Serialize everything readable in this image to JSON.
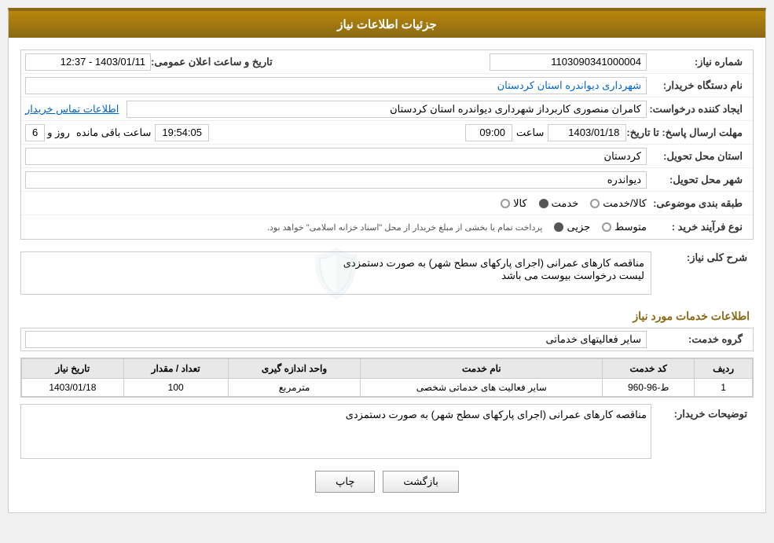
{
  "header": {
    "title": "جزئیات اطلاعات نیاز"
  },
  "fields": {
    "need_number_label": "شماره نیاز:",
    "need_number_value": "1103090341000004",
    "announce_date_label": "تاریخ و ساعت اعلان عمومی:",
    "announce_date_value": "1403/01/11 - 12:37",
    "buyer_org_label": "نام دستگاه خریدار:",
    "buyer_org_value": "شهرداری دیواندره استان کردستان",
    "creator_label": "ایجاد کننده درخواست:",
    "creator_value": "کامران منصوری کاربرداز شهرداری دیواندره استان کردستان",
    "contact_link": "اطلاعات تماس خریدار",
    "deadline_label": "مهلت ارسال پاسخ: تا تاریخ:",
    "deadline_date": "1403/01/18",
    "deadline_time_label": "ساعت",
    "deadline_time": "09:00",
    "deadline_day_label": "روز و",
    "deadline_days": "6",
    "deadline_remaining_label": "ساعت باقی مانده",
    "deadline_remaining": "19:54:05",
    "province_label": "استان محل تحویل:",
    "province_value": "کردستان",
    "city_label": "شهر محل تحویل:",
    "city_value": "دیواندره",
    "category_label": "طبقه بندی موضوعی:",
    "category_kala": "کالا",
    "category_khadamat": "خدمت",
    "category_kala_khadamat": "کالا/خدمت",
    "process_label": "نوع فرآیند خرید :",
    "process_jozi": "جزیی",
    "process_motawaset": "متوسط",
    "process_note": "پرداخت تمام یا بخشی از مبلغ خریدار از محل \"اسناد خزانه اسلامی\" خواهد بود.",
    "need_description_label": "شرح کلی نیاز:",
    "need_description": "مناقصه کارهای عمرانی (اجرای پارکهای سطح شهر) به صورت دستمزدی\nلیست درخواست بیوست می باشد",
    "services_section_title": "اطلاعات خدمات مورد نیاز",
    "service_group_label": "گروه خدمت:",
    "service_group_value": "سایر فعالیتهای خدماتی",
    "table": {
      "col_row": "ردیف",
      "col_code": "کد خدمت",
      "col_name": "نام خدمت",
      "col_unit": "واحد اندازه گیری",
      "col_qty": "تعداد / مقدار",
      "col_date": "تاریخ نیاز",
      "rows": [
        {
          "row": "1",
          "code": "ط-96-960",
          "name": "سایر فعالیت های خدماتی شخصی",
          "unit": "مترمربع",
          "qty": "100",
          "date": "1403/01/18"
        }
      ]
    },
    "buyer_desc_label": "توضیحات خریدار:",
    "buyer_desc": "مناقصه کارهای عمرانی (اجرای پارکهای سطح شهر) به صورت دستمزدی"
  },
  "buttons": {
    "print": "چاپ",
    "back": "بازگشت"
  }
}
